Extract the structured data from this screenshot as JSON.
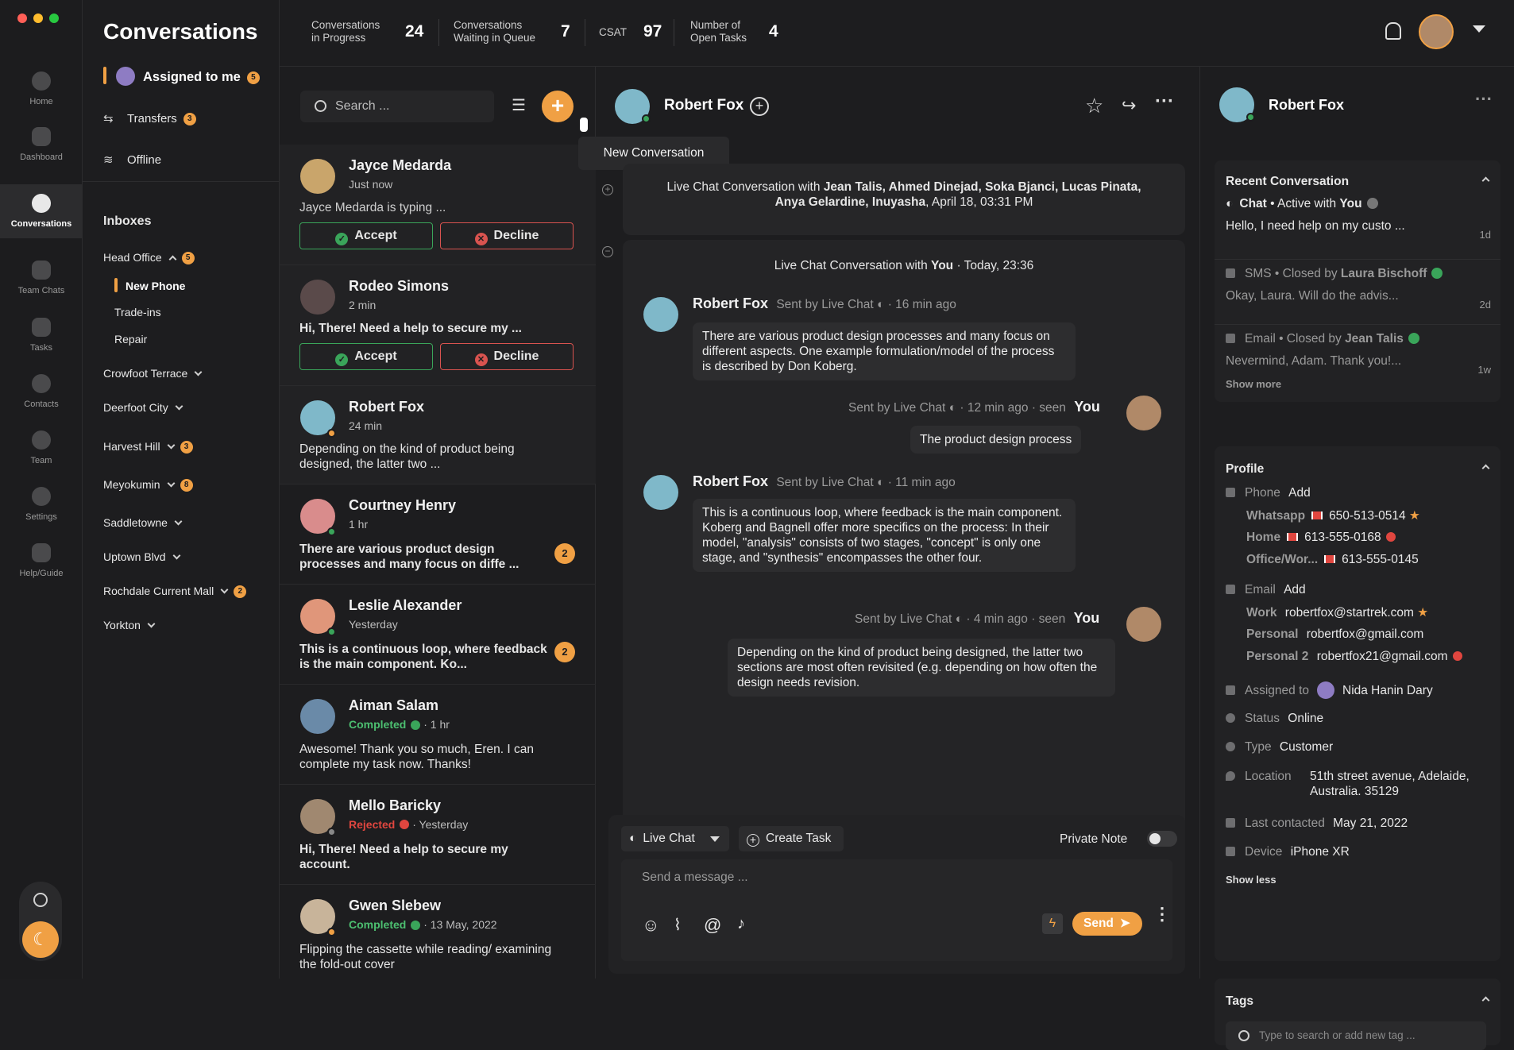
{
  "topbar": {
    "title": "Conversations",
    "stats": [
      {
        "label1": "Conversations",
        "label2": "in Progress",
        "value": "24"
      },
      {
        "label1": "Conversations",
        "label2": "Waiting in Queue",
        "value": "7"
      },
      {
        "label1": "CSAT",
        "label2": "",
        "value": "97"
      },
      {
        "label1": "Number of",
        "label2": "Open Tasks",
        "value": "4"
      }
    ]
  },
  "nav": [
    {
      "label": "Home",
      "icon": "home-icon"
    },
    {
      "label": "Dashboard",
      "icon": "dashboard-icon"
    },
    {
      "label": "Conversations",
      "icon": "conversations-icon"
    },
    {
      "label": "Team Chats",
      "icon": "team-chats-icon"
    },
    {
      "label": "Tasks",
      "icon": "tasks-icon"
    },
    {
      "label": "Contacts",
      "icon": "contacts-icon"
    },
    {
      "label": "Team",
      "icon": "team-icon"
    },
    {
      "label": "Settings",
      "icon": "settings-icon"
    },
    {
      "label": "Help/Guide",
      "icon": "help-icon"
    }
  ],
  "sidebar": {
    "assigned": "Assigned to me",
    "assigned_count": "5",
    "transfers": "Transfers",
    "transfers_count": "3",
    "offline": "Offline",
    "inboxes_title": "Inboxes",
    "inboxes": [
      {
        "name": "Head Office",
        "count": "5"
      },
      {
        "name": "Crowfoot Terrace"
      },
      {
        "name": "Deerfoot City"
      },
      {
        "name": "Harvest Hill",
        "count": "3"
      },
      {
        "name": "Meyokumin",
        "count": "8"
      },
      {
        "name": "Saddletowne"
      },
      {
        "name": "Uptown Blvd"
      },
      {
        "name": "Rochdale Current Mall",
        "count": "2"
      },
      {
        "name": "Yorkton"
      }
    ],
    "sub": [
      "New Phone",
      "Trade-ins",
      "Repair"
    ]
  },
  "list": {
    "search_placeholder": "Search ...",
    "tooltip": "New Conversation",
    "accept": "Accept",
    "decline": "Decline",
    "items": [
      {
        "name": "Jayce Medarda",
        "time": "Just now",
        "msg": "Jayce Medarda is typing ..."
      },
      {
        "name": "Rodeo Simons",
        "time": "2 min",
        "msg": "Hi, There! Need a help to secure my ..."
      },
      {
        "name": "Robert Fox",
        "time": "24 min",
        "msg": "Depending on the kind of product being designed, the latter two ..."
      },
      {
        "name": "Courtney Henry",
        "time": "1 hr",
        "msg": "There are various product design processes and many focus on diffe ...",
        "count": "2"
      },
      {
        "name": "Leslie Alexander",
        "time": "Yesterday",
        "msg": "This is a continuous loop, where feedback is the main component. Ko...",
        "count": "2"
      },
      {
        "name": "Aiman Salam",
        "status": "Completed",
        "time": "· 1 hr",
        "msg": "Awesome! Thank you so much, Eren. I can complete my task now. Thanks!"
      },
      {
        "name": "Mello Baricky",
        "status": "Rejected",
        "time": "· Yesterday",
        "msg": "Hi, There! Need a help to secure my account."
      },
      {
        "name": "Gwen Slebew",
        "status": "Completed",
        "time": "· 13 May, 2022",
        "msg": "Flipping the cassette while reading/ examining the fold-out cover"
      }
    ]
  },
  "chat": {
    "contact": "Robert Fox",
    "prev_title": "Live Chat Conversation with",
    "prev_names": "Jean Talis, Ahmed Dinejad, Soka Bjanci, Lucas Pinata,",
    "prev_names2": "Anya Gelardine, Inuyasha",
    "prev_date": "April 18, 03:31 PM",
    "cur_title": "Live Chat Conversation with",
    "cur_you": "You",
    "cur_date": "· Today, 23:36",
    "messages": [
      {
        "from": "Robert Fox",
        "meta": "Sent by Live Chat",
        "time": "· 16 min ago",
        "text": "There are various product design processes and many focus on different aspects. One example formulation/model of the process is described by Don Koberg."
      },
      {
        "meta": "Sent by Live Chat",
        "time": "· 12 min ago · seen",
        "from": "You",
        "text": "The product design process"
      },
      {
        "from": "Robert Fox",
        "meta": "Sent by Live Chat",
        "time": "· 11 min ago",
        "text": "This is a continuous loop, where feedback is the main component. Koberg and Bagnell offer more specifics on the process: In their model, \"analysis\" consists of two stages, \"concept\" is only one stage, and \"synthesis\" encompasses the other four."
      },
      {
        "meta": "Sent by Live Chat",
        "time": "· 4 min ago · seen",
        "from": "You",
        "text": "Depending on the kind of product being designed, the latter two sections are most often revisited (e.g. depending on how often the design needs revision."
      }
    ],
    "channel": "Live Chat",
    "create_task": "Create Task",
    "private_note": "Private Note",
    "placeholder": "Send a message ...",
    "send": "Send"
  },
  "profile": {
    "name": "Robert Fox",
    "recent_title": "Recent Conversation",
    "recent": [
      {
        "channel": "Chat",
        "status": "• Active with",
        "who": "You",
        "preview": "Hello, I need help on my custo ...",
        "age": "1d"
      },
      {
        "channel": "SMS",
        "status": "• Closed by",
        "who": "Laura Bischoff",
        "preview": "Okay, Laura. Will do the advis...",
        "age": "2d"
      },
      {
        "channel": "Email",
        "status": "• Closed by",
        "who": "Jean Talis",
        "preview": "Nevermind, Adam. Thank you!...",
        "age": "1w"
      }
    ],
    "show_more": "Show more",
    "profile_title": "Profile",
    "phone_label": "Phone",
    "add": "Add",
    "whatsapp_label": "Whatsapp",
    "whatsapp": "650-513-0514",
    "home_label": "Home",
    "home": "613-555-0168",
    "office_label": "Office/Wor...",
    "office": "613-555-0145",
    "email_label": "Email",
    "work_label": "Work",
    "work": "robertfox@startrek.com",
    "personal_label": "Personal",
    "personal": "robertfox@gmail.com",
    "personal2_label": "Personal 2",
    "personal2": "robertfox21@gmail.com",
    "assigned_label": "Assigned to",
    "assigned": "Nida Hanin Dary",
    "status_label": "Status",
    "status": "Online",
    "type_label": "Type",
    "type": "Customer",
    "location_label": "Location",
    "location1": "51th street avenue, Adelaide,",
    "location2": "Australia. 35129",
    "last_label": "Last contacted",
    "last": "May 21, 2022",
    "device_label": "Device",
    "device": "iPhone XR",
    "show_less": "Show less",
    "tags_title": "Tags",
    "tags_placeholder": "Type to search or add new tag ..."
  }
}
